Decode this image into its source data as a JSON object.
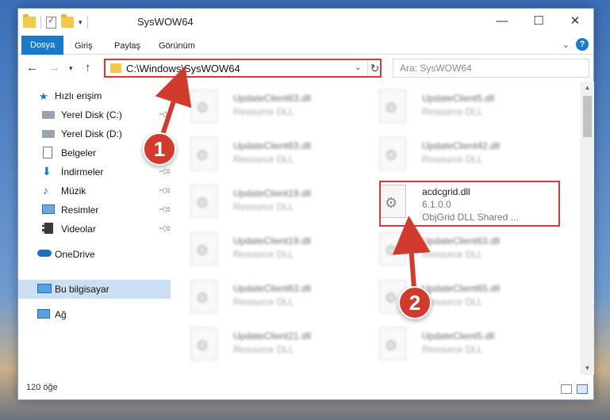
{
  "window": {
    "title": "SysWOW64",
    "controls": {
      "minimize": "—",
      "maximize": "☐",
      "close": "✕"
    }
  },
  "ribbon": {
    "tabs": [
      "Dosya",
      "Giriş",
      "Paylaş",
      "Görünüm"
    ],
    "help": "?"
  },
  "address": {
    "path": "C:\\Windows\\SysWOW64",
    "search_placeholder": "Ara: SysWOW64"
  },
  "sidebar": {
    "items": [
      {
        "label": "Hızlı erişim",
        "icon": "star-icon",
        "pinned": false
      },
      {
        "label": "Yerel Disk (C:)",
        "icon": "drive-icon",
        "pinned": true
      },
      {
        "label": "Yerel Disk (D:)",
        "icon": "drive-icon",
        "pinned": false
      },
      {
        "label": "Belgeler",
        "icon": "documents-icon",
        "pinned": true
      },
      {
        "label": "İndirmeler",
        "icon": "downloads-icon",
        "pinned": true
      },
      {
        "label": "Müzik",
        "icon": "music-icon",
        "pinned": true
      },
      {
        "label": "Resimler",
        "icon": "pictures-icon",
        "pinned": true
      },
      {
        "label": "Videolar",
        "icon": "videos-icon",
        "pinned": true
      },
      {
        "label": "OneDrive",
        "icon": "cloud-icon",
        "pinned": false
      },
      {
        "label": "Bu bilgisayar",
        "icon": "computer-icon",
        "pinned": false
      },
      {
        "label": "Ağ",
        "icon": "network-icon",
        "pinned": false
      }
    ]
  },
  "files": {
    "left": [
      {
        "name": "UpdateClient63.dll",
        "sub": "Resource DLL"
      },
      {
        "name": "UpdateClient63.dll",
        "sub": "Resource DLL"
      },
      {
        "name": "UpdateClient19.dll",
        "sub": "Resource DLL"
      },
      {
        "name": "UpdateClient19.dll",
        "sub": "Resource DLL"
      },
      {
        "name": "UpdateClient63.dll",
        "sub": "Resource DLL"
      },
      {
        "name": "UpdateClient21.dll",
        "sub": "Resource DLL"
      }
    ],
    "right": [
      {
        "name": "UpdateClient5.dll",
        "sub": "Resource DLL"
      },
      {
        "name": "UpdateClient42.dll",
        "sub": "Resource DLL"
      },
      {
        "name": "acdcgrid.dll",
        "version": "6.1.0.0",
        "desc": "ObjGrid DLL Shared ..."
      },
      {
        "name": "UpdateClient63.dll",
        "sub": "Resource DLL"
      },
      {
        "name": "UpdateClient65.dll",
        "sub": "Resource DLL"
      },
      {
        "name": "UpdateClient5.dll",
        "sub": "Resource DLL"
      }
    ]
  },
  "status": {
    "count": "120 öğe"
  },
  "annotations": {
    "step1": "1",
    "step2": "2",
    "accent": "#e0343c"
  }
}
